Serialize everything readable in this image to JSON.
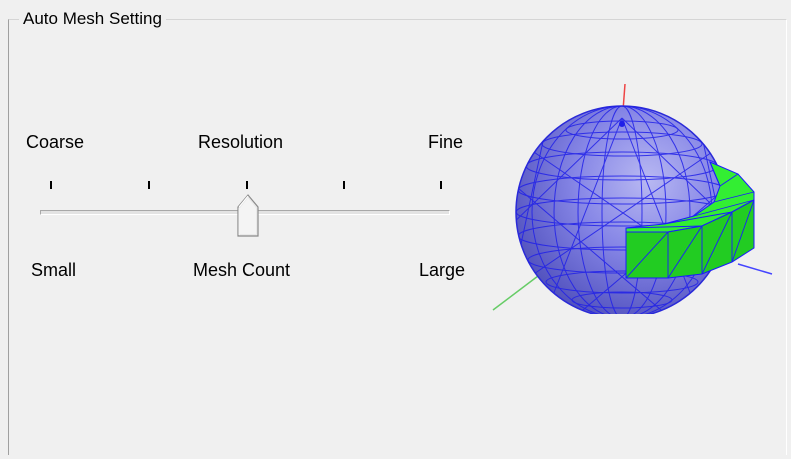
{
  "group": {
    "title": "Auto Mesh Setting"
  },
  "slider": {
    "top_left_label": "Coarse",
    "top_center_label": "Resolution",
    "top_right_label": "Fine",
    "bottom_left_label": "Small",
    "bottom_center_label": "Mesh Count",
    "bottom_right_label": "Large",
    "tick_count": 5,
    "value_fraction": 0.5
  },
  "preview": {
    "icon": "sphere-mesh-preview",
    "colors": {
      "sphere": "#7a7ae0",
      "mesh_lines": "#1a1aff",
      "band": "#22dd22",
      "axis_x": "#ee3333",
      "axis_y": "#66cc66",
      "axis_z": "#4444ff"
    }
  }
}
